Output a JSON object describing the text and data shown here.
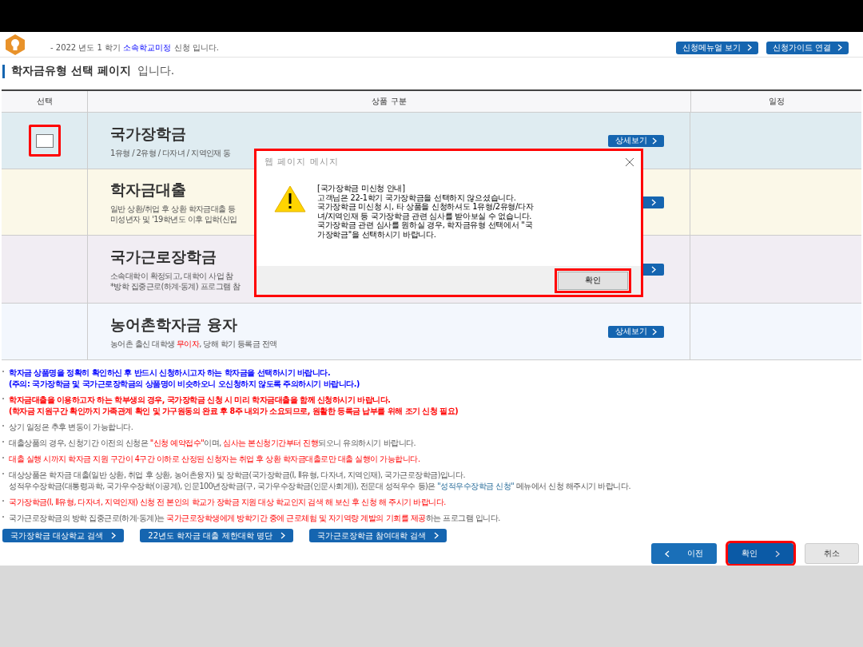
{
  "header": {
    "notice": [
      {
        "text": "- 2022 년도 1 학기 ",
        "kind": "plain"
      },
      {
        "text": "소속학교미정",
        "kind": "info"
      },
      {
        "text": " 신청 입니다.",
        "kind": "plain"
      }
    ],
    "buttons": [
      "신청메뉴얼 보기",
      "신청가이드 연결"
    ]
  },
  "page_title": {
    "main": "학자금유형 선택 페이지",
    "suffix": "입니다."
  },
  "table": {
    "columns": [
      "선택",
      "상품 구분",
      "일정"
    ],
    "rows": [
      {
        "title": "국가장학금",
        "desc": [
          [
            {
              "text": "1유형 / 2유형 / 다자녀 / 지역인재 동",
              "kind": "plain"
            }
          ]
        ],
        "detail": "상세보기",
        "checkbox": {
          "checked": false,
          "highlighted": true
        }
      },
      {
        "title": "학자금대출",
        "desc": [
          [
            {
              "text": "일반 상환/취업 후 상환 학자금대출 등",
              "kind": "plain"
            }
          ],
          [
            {
              "text": "미성년자 및 '19학년도 이후 입학(신입",
              "kind": "plain"
            }
          ]
        ]
      },
      {
        "title": "국가근로장학금",
        "desc": [
          [
            {
              "text": "소속대학이 확정되고, 대학이 사업 참",
              "kind": "plain"
            }
          ],
          [
            {
              "text": "*방학 집중근로(하계·동계) 프로그램 참",
              "kind": "plain"
            }
          ]
        ]
      },
      {
        "title": "농어촌학자금 융자",
        "desc": [
          [
            {
              "text": "농어촌 출신 대학생 ",
              "kind": "plain"
            },
            {
              "text": "무이자",
              "kind": "alert"
            },
            {
              "text": ", 당해 학기 등록금 전액",
              "kind": "plain"
            }
          ]
        ],
        "detail": "상세보기"
      }
    ]
  },
  "notes": [
    {
      "bold": true,
      "lines": [
        [
          {
            "text": "학자금 상품명을 정확히 확인하신 후 반드시 신청하시고자 하는 학자금을 선택하시기 바랍니다.",
            "kind": "info"
          }
        ],
        [
          {
            "text": "(주의: 국가장학금 및 국가근로장학금의 상품명이 비슷하오니 오신청하지 않도록 주의하시기 바랍니다.)",
            "kind": "info"
          }
        ]
      ]
    },
    {
      "bold": true,
      "lines": [
        [
          {
            "text": "학자금대출을 이용하고자 하는 학부생의 경우, 국가장학금 신청 시 미리 학자금대출을 함께 신청하시기 바랍니다.",
            "kind": "alert"
          }
        ],
        [
          {
            "text": "(학자금 지원구간 확인까지 가족관계 확인 및 가구원동의 완료 후 8주 내외가 소요되므로, 원활한 등록금 납부를 위해 조기 신청 필요)",
            "kind": "alert"
          }
        ]
      ]
    },
    {
      "bold": false,
      "lines": [
        [
          {
            "text": "상기 일정은 추후 변동이 가능합니다.",
            "kind": "plain"
          }
        ]
      ]
    },
    {
      "bold": false,
      "lines": [
        [
          {
            "text": "대출상품의 경우, 신청기간 이전의 신청은 ",
            "kind": "plain"
          },
          {
            "text": "\"신청 예약접수\"",
            "kind": "alert"
          },
          {
            "text": "이며, ",
            "kind": "plain"
          },
          {
            "text": "심사는 본신청기간부터 진행",
            "kind": "alert"
          },
          {
            "text": "되오니 유의하시기 바랍니다.",
            "kind": "plain"
          }
        ]
      ]
    },
    {
      "bold": false,
      "lines": [
        [
          {
            "text": "대출 실행 시까지 학자금 지원 구간이 4구간 이하로 산정된 신청자는 취업 후 상환 학자금대출로만 대출 실행이 가능합니다.",
            "kind": "alert"
          }
        ]
      ]
    },
    {
      "bold": false,
      "lines": [
        [
          {
            "text": "대상상품은 학자금 대출(일반 상환, 취업 후 상환, 농어촌융자) 및 장학금(국가장학금(Ⅰ, Ⅱ유형, 다자녀, 지역인재), 국가근로장학금)입니다.",
            "kind": "plain"
          }
        ],
        [
          {
            "text": "성적우수장학금(대통령과학, 국가우수장학(이공계), 인문100년장학금(구, 국가우수장학금(인문사회계)), 전문대 성적우수 등)은 ",
            "kind": "plain"
          },
          {
            "text": "\"성적우수장학금 신청\"",
            "kind": "menu"
          },
          {
            "text": " 메뉴에서 신청 해주시기 바랍니다.",
            "kind": "plain"
          }
        ]
      ]
    },
    {
      "bold": false,
      "lines": [
        [
          {
            "text": "국가장학금(Ⅰ, Ⅱ유형, 다자녀, 지역인재) 신청 전 본인의 학교가 장학금 지원 대상 학교인지 검색 해 보신 후 신청 해 주시기 바랍니다.",
            "kind": "alert"
          }
        ]
      ]
    },
    {
      "bold": false,
      "lines": [
        [
          {
            "text": "국가근로장학금의 방학 집중근로(하계·동계)는 ",
            "kind": "plain"
          },
          {
            "text": "국가근로장학생에게 방학기간 중에 근로체험 및 자기역량 계발의 기회를 제공",
            "kind": "alert"
          },
          {
            "text": "하는 프로그램 입니다.",
            "kind": "plain"
          }
        ]
      ]
    }
  ],
  "links": [
    "국가장학금 대상학교 검색",
    "22년도 학자금 대출 제한대학 명단",
    "국가근로장학금 참여대학 검색"
  ],
  "nav": [
    {
      "label": "이전",
      "kind": "prev",
      "highlighted": false
    },
    {
      "label": "확인",
      "kind": "next",
      "highlighted": true
    },
    {
      "label": "취소",
      "kind": "cancel",
      "highlighted": false
    }
  ],
  "dialog": {
    "title": "웹 페이지 메시지",
    "message": "[국가장학금 미신청 안내]\n고객님은 22-1학기 국가장학금을 선택하지 않으셨습니다.\n국가장학금 미신청 시, 타 상품을 신청하셔도 1유형/2유형/다자\n녀/지역인재 등 국가장학금 관련 심사를 받아보실 수 없습니다.\n국가장학금 관련 심사를 원하실 경우, 학자금유형 선택에서 \"국\n가장학금\"을 선택하시기 바랍니다.",
    "button": "확인",
    "highlighted": true,
    "button_highlighted": true
  }
}
